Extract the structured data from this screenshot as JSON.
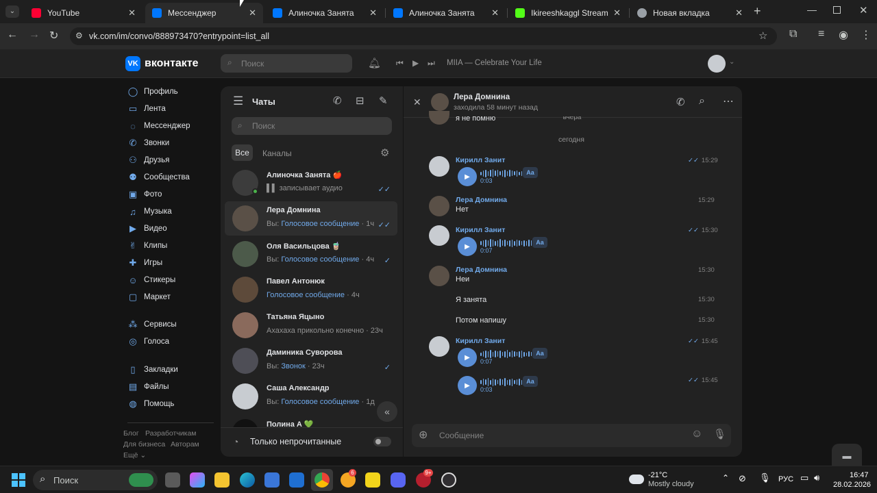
{
  "browser": {
    "tabs": [
      {
        "title": "YouTube",
        "favicon_color": "#ff0033",
        "active": false
      },
      {
        "title": "Мессенджер",
        "favicon_color": "#0077ff",
        "active": true
      },
      {
        "title": "Алиночка Занята",
        "favicon_color": "#0077ff",
        "active": false
      },
      {
        "title": "Алиночка Занята",
        "favicon_color": "#0077ff",
        "active": false
      },
      {
        "title": "Ikireeshkaggl Stream - Wa",
        "favicon_color": "#53fc18",
        "active": false
      },
      {
        "title": "Новая вкладка",
        "favicon_color": "#9aa0a6",
        "active": false
      }
    ],
    "url": "vk.com/im/convo/888973470?entrypoint=list_all"
  },
  "vk_header": {
    "logo_text": "вконтакте",
    "search_placeholder": "Поиск",
    "now_playing": "MIIA — Celebrate Your Life"
  },
  "left_nav": {
    "items": [
      {
        "label": "Профиль",
        "icon": "user-circle-icon"
      },
      {
        "label": "Лента",
        "icon": "news-icon"
      },
      {
        "label": "Мессенджер",
        "icon": "message-icon"
      },
      {
        "label": "Звонки",
        "icon": "phone-icon"
      },
      {
        "label": "Друзья",
        "icon": "users-icon"
      },
      {
        "label": "Сообщества",
        "icon": "groups-icon"
      },
      {
        "label": "Фото",
        "icon": "photo-icon"
      },
      {
        "label": "Музыка",
        "icon": "music-icon"
      },
      {
        "label": "Видео",
        "icon": "video-icon"
      },
      {
        "label": "Клипы",
        "icon": "clips-icon"
      },
      {
        "label": "Игры",
        "icon": "gamepad-icon"
      },
      {
        "label": "Стикеры",
        "icon": "sticker-icon"
      },
      {
        "label": "Маркет",
        "icon": "market-icon"
      },
      {
        "label": "Сервисы",
        "icon": "services-icon"
      },
      {
        "label": "Голоса",
        "icon": "coins-icon"
      },
      {
        "label": "Закладки",
        "icon": "bookmark-icon"
      },
      {
        "label": "Файлы",
        "icon": "file-icon"
      },
      {
        "label": "Помощь",
        "icon": "help-icon"
      }
    ],
    "footer": {
      "blog": "Блог",
      "devs": "Разработчикам",
      "business": "Для бизнеса",
      "authors": "Авторам",
      "more": "Ещё ⌄"
    }
  },
  "chat_list": {
    "title": "Чаты",
    "search_placeholder": "Поиск",
    "tabs": [
      "Все",
      "Каналы"
    ],
    "unread_only_label": "Только непрочитанные",
    "items": [
      {
        "name": "Алиночка Занята 🍎",
        "prefix": "",
        "preview": "▌▌ записывает аудио",
        "time": "",
        "check": "✓✓",
        "avatar_color": "#3c3c3c"
      },
      {
        "name": "Лера Домнина",
        "prefix": "Вы: ",
        "preview": "Голосовое сообщение",
        "time": " · 1ч",
        "check": "✓✓",
        "avatar_color": "#5a5047"
      },
      {
        "name": "Оля Васильцова 🧋",
        "prefix": "Вы: ",
        "preview": "Голосовое сообщение",
        "time": " · 4ч",
        "check": "✓",
        "avatar_color": "#4c5a4a"
      },
      {
        "name": "Павел Антонюк",
        "prefix": "",
        "preview": "Голосовое сообщение",
        "time": " · 4ч",
        "check": "",
        "avatar_color": "#5d4a3a"
      },
      {
        "name": "Татьяна Яцыно",
        "prefix": "",
        "preview": "Ахахаха прикольно конечно",
        "time": " · 23ч",
        "check": "",
        "avatar_color": "#8a6a5c"
      },
      {
        "name": "Даминика Суворова",
        "prefix": "Вы: ",
        "preview": "Звонок",
        "time": " · 23ч",
        "check": "✓",
        "avatar_color": "#4e4e56"
      },
      {
        "name": "Саша Александр",
        "prefix": "Вы: ",
        "preview": "Голосовое сообщение",
        "time": " · 1д",
        "check": "",
        "avatar_color": "#c8ccd1"
      },
      {
        "name": "Полина А 💚",
        "prefix": "",
        "preview": "",
        "time": "",
        "check": "",
        "avatar_color": "#222222"
      }
    ]
  },
  "conversation": {
    "contact_name": "Лера Домнина",
    "contact_status": "заходила 58 минут назад",
    "cut_text": "я не помню",
    "yesterday_label": "вчера",
    "date_separator": "сегодня",
    "input_placeholder": "Сообщение",
    "messages": [
      {
        "author": "Кирилл Занит",
        "type": "voice",
        "duration": "0:03",
        "time": "15:29",
        "read": "✓✓"
      },
      {
        "author": "Лера Домнина",
        "type": "text",
        "text": "Нет",
        "time": "15:29",
        "read": ""
      },
      {
        "author": "Кирилл Занит",
        "type": "voice",
        "duration": "0:07",
        "time": "15:30",
        "read": "✓✓"
      },
      {
        "author": "Лера Домнина",
        "type": "text",
        "text": "Неи",
        "time": "15:30",
        "read": ""
      },
      {
        "author": "",
        "type": "text",
        "text": "Я занята",
        "time": "15:30",
        "read": ""
      },
      {
        "author": "",
        "type": "text",
        "text": "Потом напишу",
        "time": "15:30",
        "read": ""
      },
      {
        "author": "Кирилл Занит",
        "type": "voice",
        "duration": "0:07",
        "time": "15:45",
        "read": "✓✓"
      },
      {
        "author": "",
        "type": "voice",
        "duration": "0:03",
        "time": "15:45",
        "read": "✓✓"
      }
    ],
    "transcribe_label": "Aa"
  },
  "taskbar": {
    "search_label": "Поиск",
    "weather_temp": "-21°C",
    "weather_desc": "Mostly cloudy",
    "language": "РУС",
    "time": "16:47",
    "date": "28.02.2026",
    "badges": {
      "app1": "6",
      "app2": "9+"
    }
  }
}
